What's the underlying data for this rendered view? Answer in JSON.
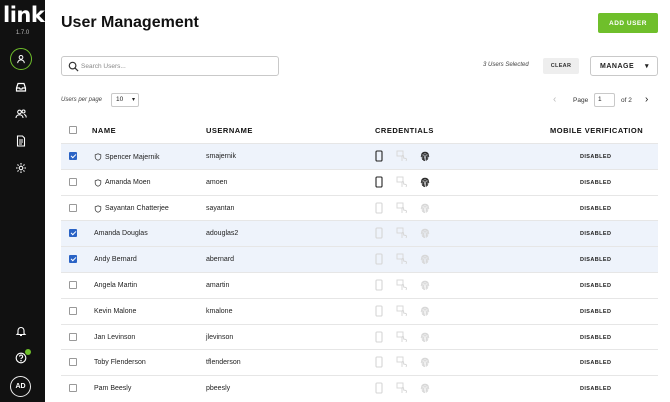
{
  "sidebar": {
    "logo": "link",
    "version": "1.7.0",
    "icons": [
      "profile-icon",
      "inbox-icon",
      "users-icon",
      "document-icon",
      "gear-icon",
      "bell-icon",
      "help-icon"
    ],
    "avatar_initials": "AD",
    "accent_color": "#6fbf2b"
  },
  "header": {
    "title": "User Management",
    "add_user_label": "ADD USER"
  },
  "toolbar": {
    "search_placeholder": "Search Users...",
    "search_value": "",
    "selected_text": "3 Users Selected",
    "clear_label": "CLEAR",
    "manage_label": "MANAGE"
  },
  "pagination": {
    "per_page_label": "Users per page",
    "per_page_value": "10",
    "page_label": "Page",
    "page_value": "1",
    "total_label": "of 2"
  },
  "table": {
    "columns": {
      "name": "NAME",
      "username": "USERNAME",
      "credentials": "CREDENTIALS",
      "mobile": "MOBILE VERIFICATION"
    },
    "rows": [
      {
        "name": "Spencer Majernik",
        "username": "smajernik",
        "selected": true,
        "shield": true,
        "phone": true,
        "touch": false,
        "fingerprint": true,
        "status": "DISABLED"
      },
      {
        "name": "Amanda Moen",
        "username": "amoen",
        "selected": false,
        "shield": true,
        "phone": true,
        "touch": false,
        "fingerprint": true,
        "status": "DISABLED"
      },
      {
        "name": "Sayantan Chatterjee",
        "username": "sayantan",
        "selected": false,
        "shield": true,
        "phone": false,
        "touch": false,
        "fingerprint": false,
        "status": "DISABLED"
      },
      {
        "name": "Amanda Douglas",
        "username": "adouglas2",
        "selected": true,
        "shield": false,
        "phone": false,
        "touch": false,
        "fingerprint": false,
        "status": "DISABLED"
      },
      {
        "name": "Andy Bernard",
        "username": "abernard",
        "selected": true,
        "shield": false,
        "phone": false,
        "touch": false,
        "fingerprint": false,
        "status": "DISABLED"
      },
      {
        "name": "Angela Martin",
        "username": "amartin",
        "selected": false,
        "shield": false,
        "phone": false,
        "touch": false,
        "fingerprint": false,
        "status": "DISABLED"
      },
      {
        "name": "Kevin Malone",
        "username": "kmalone",
        "selected": false,
        "shield": false,
        "phone": false,
        "touch": false,
        "fingerprint": false,
        "status": "DISABLED"
      },
      {
        "name": "Jan Levinson",
        "username": "jlevinson",
        "selected": false,
        "shield": false,
        "phone": false,
        "touch": false,
        "fingerprint": false,
        "status": "DISABLED"
      },
      {
        "name": "Toby Flenderson",
        "username": "tflenderson",
        "selected": false,
        "shield": false,
        "phone": false,
        "touch": false,
        "fingerprint": false,
        "status": "DISABLED"
      },
      {
        "name": "Pam Beesly",
        "username": "pbeesly",
        "selected": false,
        "shield": false,
        "phone": false,
        "touch": false,
        "fingerprint": false,
        "status": "DISABLED"
      }
    ]
  },
  "colors": {
    "selected_row": "#eef3fb",
    "checkbox": "#2a63c5",
    "active_icon": "#222222",
    "inactive_icon": "#d6d6d6"
  }
}
